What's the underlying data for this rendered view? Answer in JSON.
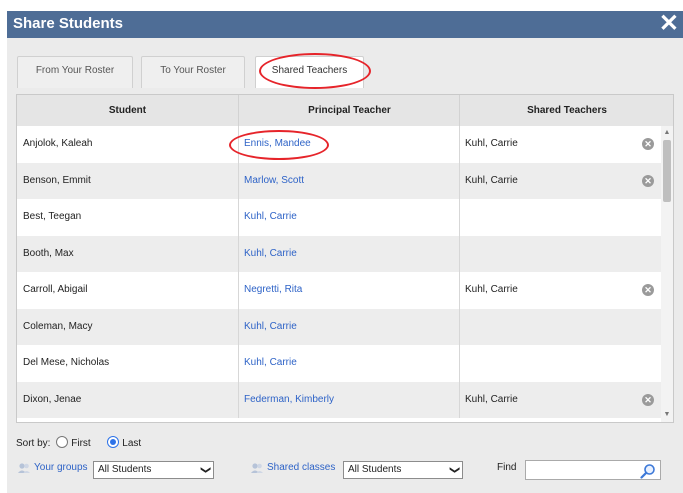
{
  "dialog": {
    "title": "Share Students",
    "close_glyph": "✕"
  },
  "tabs": [
    {
      "label": "From Your Roster",
      "active": false
    },
    {
      "label": "To Your Roster",
      "active": false
    },
    {
      "label": "Shared Teachers",
      "active": true
    }
  ],
  "grid": {
    "headers": {
      "student": "Student",
      "principal": "Principal Teacher",
      "shared": "Shared Teachers"
    },
    "rows": [
      {
        "student": "Anjolok, Kaleah",
        "principal": "Ennis, Mandee",
        "shared": "Kuhl, Carrie",
        "removable": true
      },
      {
        "student": "Benson, Emmit",
        "principal": "Marlow, Scott",
        "shared": "Kuhl, Carrie",
        "removable": true
      },
      {
        "student": "Best, Teegan",
        "principal": "Kuhl, Carrie",
        "shared": "",
        "removable": false
      },
      {
        "student": "Booth, Max",
        "principal": "Kuhl, Carrie",
        "shared": "",
        "removable": false
      },
      {
        "student": "Carroll, Abigail",
        "principal": "Negretti, Rita",
        "shared": "Kuhl, Carrie",
        "removable": true
      },
      {
        "student": "Coleman, Macy",
        "principal": "Kuhl, Carrie",
        "shared": "",
        "removable": false
      },
      {
        "student": "Del Mese, Nicholas",
        "principal": "Kuhl, Carrie",
        "shared": "",
        "removable": false
      },
      {
        "student": "Dixon, Jenae",
        "principal": "Federman, Kimberly",
        "shared": "Kuhl, Carrie",
        "removable": true
      }
    ]
  },
  "sort": {
    "label": "Sort by:",
    "first": "First",
    "last": "Last",
    "selected": "Last"
  },
  "filters": {
    "groups_link": "Your groups",
    "groups_value": "All Students",
    "shared_link": "Shared classes",
    "shared_value": "All Students",
    "find_label": "Find",
    "find_value": ""
  },
  "colors": {
    "title_bar": "#4e6d96",
    "link": "#2e63c7",
    "annotation": "#e6242a"
  }
}
